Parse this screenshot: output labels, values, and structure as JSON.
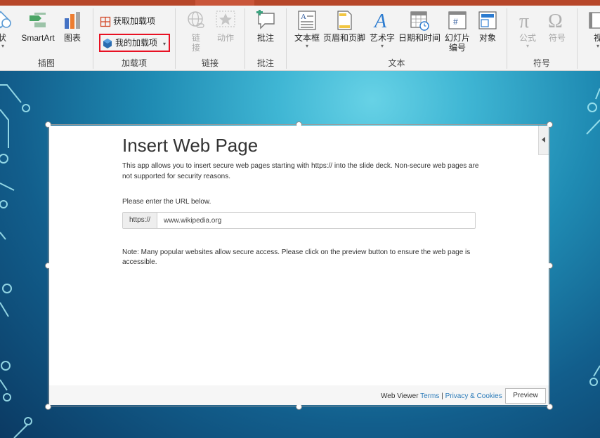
{
  "ribbon": {
    "groups": {
      "illustrations": {
        "shapes_label": "形状",
        "smartart_label": "SmartArt",
        "chart_label": "图表",
        "group_label": "插图"
      },
      "addins": {
        "get_label": "获取加载项",
        "my_label": "我的加载项",
        "group_label": "加载项"
      },
      "links": {
        "link_label_1": "链",
        "link_label_2": "接",
        "action_label": "动作",
        "group_label": "链接"
      },
      "comments": {
        "comment_label": "批注",
        "group_label": "批注"
      },
      "text": {
        "textbox_label": "文本框",
        "header_footer_label": "页眉和页脚",
        "wordart_label": "艺术字",
        "datetime_label": "日期和时间",
        "slide_number_label_1": "幻灯片",
        "slide_number_label_2": "编号",
        "object_label": "对象",
        "group_label": "文本"
      },
      "symbols": {
        "equation_label": "公式",
        "symbol_label": "符号",
        "group_label": "符号"
      },
      "media": {
        "video_label": "视"
      }
    }
  },
  "addin_panel": {
    "title": "Insert Web Page",
    "description": "This app allows you to insert secure web pages starting with https:// into the slide deck. Non-secure web pages are not supported for security reasons.",
    "prompt": "Please enter the URL below.",
    "url_prefix": "https://",
    "url_value": "www.wikipedia.org",
    "note": "Note: Many popular websites allow secure access. Please click on the preview button to ensure the web page is accessible.",
    "footer": {
      "brand": "Web Viewer",
      "terms_link": "Terms",
      "separator": "|",
      "privacy_link": "Privacy & Cookies",
      "preview_button": "Preview"
    }
  },
  "colors": {
    "accent": "#b7472a",
    "highlight_border": "#e81123",
    "link": "#2b7bb9"
  }
}
